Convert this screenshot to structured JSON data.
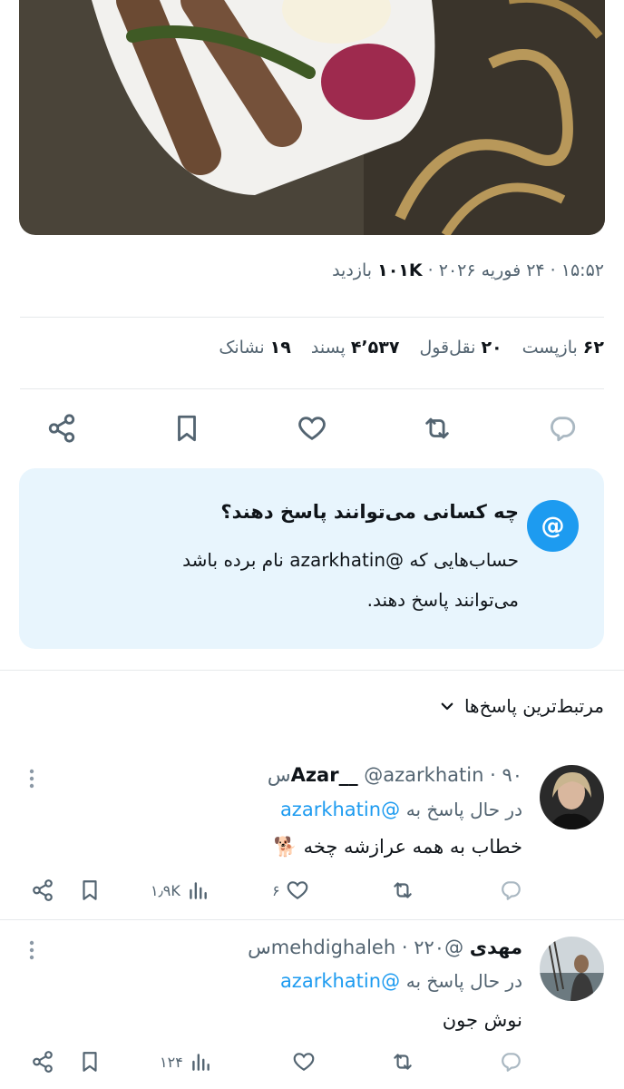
{
  "tweet": {
    "time": "۱۵:۵۲",
    "date": "۲۴ فوریه ۲۰۲۶",
    "views_count": "۱۰۱K",
    "views_label": "بازدید",
    "stats": [
      {
        "count": "۶۲",
        "label": "بازپست"
      },
      {
        "count": "۲۰",
        "label": "نقل‌قول"
      },
      {
        "count": "۴٬۵۳۷",
        "label": "پسند"
      },
      {
        "count": "۱۹",
        "label": "نشانک"
      }
    ]
  },
  "reply_info": {
    "title": "چه کسانی می‌توانند پاسخ دهند؟",
    "text": "حساب‌هایی که @azarkhatin نام برده باشد می‌توانند پاسخ دهند."
  },
  "sort": {
    "label": "مرتبط‌ترین پاسخ‌ها"
  },
  "replies": [
    {
      "display_name": "Azar__",
      "handle": "@azarkhatin",
      "time": "۹۰س",
      "replying_label": "در حال پاسخ به",
      "replying_to": "@azarkhatin",
      "body": "خطاب به همه عرازشه چخه 🐕",
      "likes": "۶",
      "views": "۱٫۹K"
    },
    {
      "display_name": "مهدی",
      "handle": "@mehdighaleh",
      "time": "۲۲۰س",
      "replying_label": "در حال پاسخ به",
      "replying_to": "@azarkhatin",
      "body": "نوش جون",
      "likes": "",
      "views": "۱۲۴"
    }
  ],
  "colors": {
    "accent": "#1d9bf0",
    "muted": "#536471",
    "info_bg": "#e8f5fd"
  },
  "icons": [
    "share-icon",
    "bookmark-icon",
    "heart-icon",
    "retweet-icon",
    "reply-icon",
    "views-icon",
    "more-icon",
    "at-icon",
    "chevron-down-icon"
  ]
}
